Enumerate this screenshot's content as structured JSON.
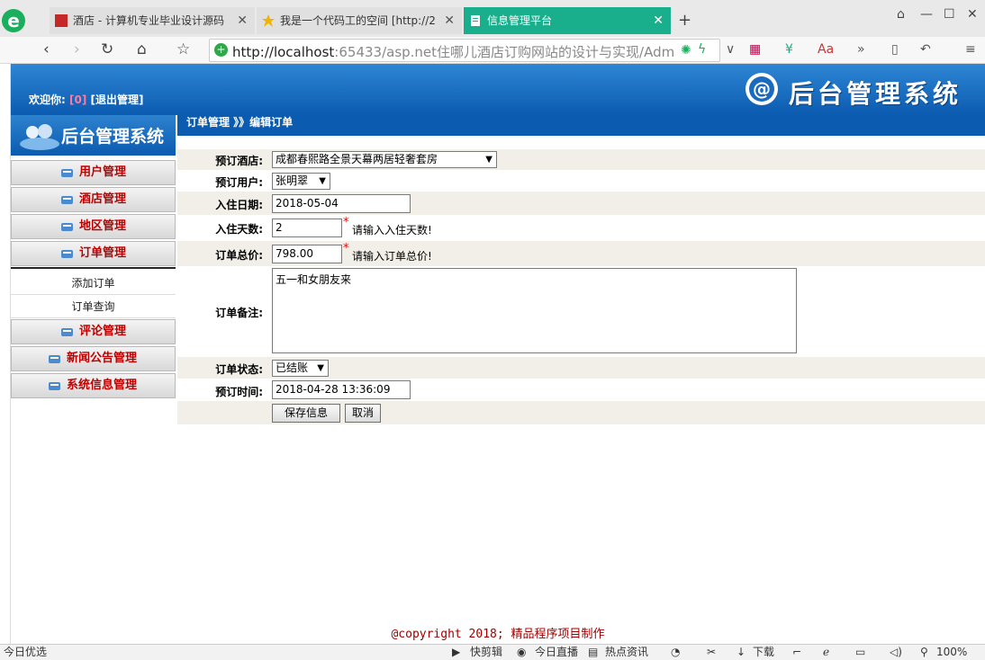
{
  "browser": {
    "tabs": [
      {
        "title": "酒店 - 计算机专业毕业设计源码",
        "active": false
      },
      {
        "title": "我是一个代码工的空间 [http://2",
        "active": false
      },
      {
        "title": "信息管理平台",
        "active": true
      }
    ],
    "new_tab": "+",
    "url_host": "http://localhost",
    "url_rest": ":65433/asp.net住哪儿酒店订购网站的设计与实现/Admi",
    "menu_icon": "≡"
  },
  "header": {
    "welcome_prefix": "欢迎你:",
    "username": "[0]",
    "logout": "[退出管理]",
    "brand": "后台管理系统"
  },
  "sidebar": {
    "title": "后台管理系统",
    "menus": [
      {
        "label": "用户管理"
      },
      {
        "label": "酒店管理"
      },
      {
        "label": "地区管理"
      },
      {
        "label": "订单管理"
      }
    ],
    "submenus": [
      {
        "label": "添加订单"
      },
      {
        "label": "订单查询"
      }
    ],
    "menus2": [
      {
        "label": "评论管理"
      },
      {
        "label": "新闻公告管理"
      },
      {
        "label": "系统信息管理"
      }
    ]
  },
  "breadcrumb": "订单管理 》》编辑订单",
  "form": {
    "hotel_label": "预订酒店:",
    "hotel_value": "成都春熙路全景天幕两居轻奢套房",
    "user_label": "预订用户:",
    "user_value": "张明翠",
    "checkin_label": "入住日期:",
    "checkin_value": "2018-05-04",
    "days_label": "入住天数:",
    "days_value": "2",
    "days_hint": "请输入入住天数!",
    "total_label": "订单总价:",
    "total_value": "798.00",
    "total_hint": "请输入订单总价!",
    "memo_label": "订单备注:",
    "memo_value": "五一和女朋友来",
    "status_label": "订单状态:",
    "status_value": "已结账",
    "time_label": "预订时间:",
    "time_value": "2018-04-28 13:36:09",
    "required_mark": "*",
    "save_label": "保存信息",
    "cancel_label": "取消"
  },
  "copyright": "@copyright 2018; 精品程序项目制作",
  "statusbar": {
    "left": "今日优选",
    "items": [
      "快剪辑",
      "今日直播",
      "热点资讯",
      "下载",
      "100%"
    ]
  },
  "colors": {
    "header_blue": "#0b5bb0",
    "menu_red": "#c00000",
    "active_tab": "#1aaf8c"
  }
}
